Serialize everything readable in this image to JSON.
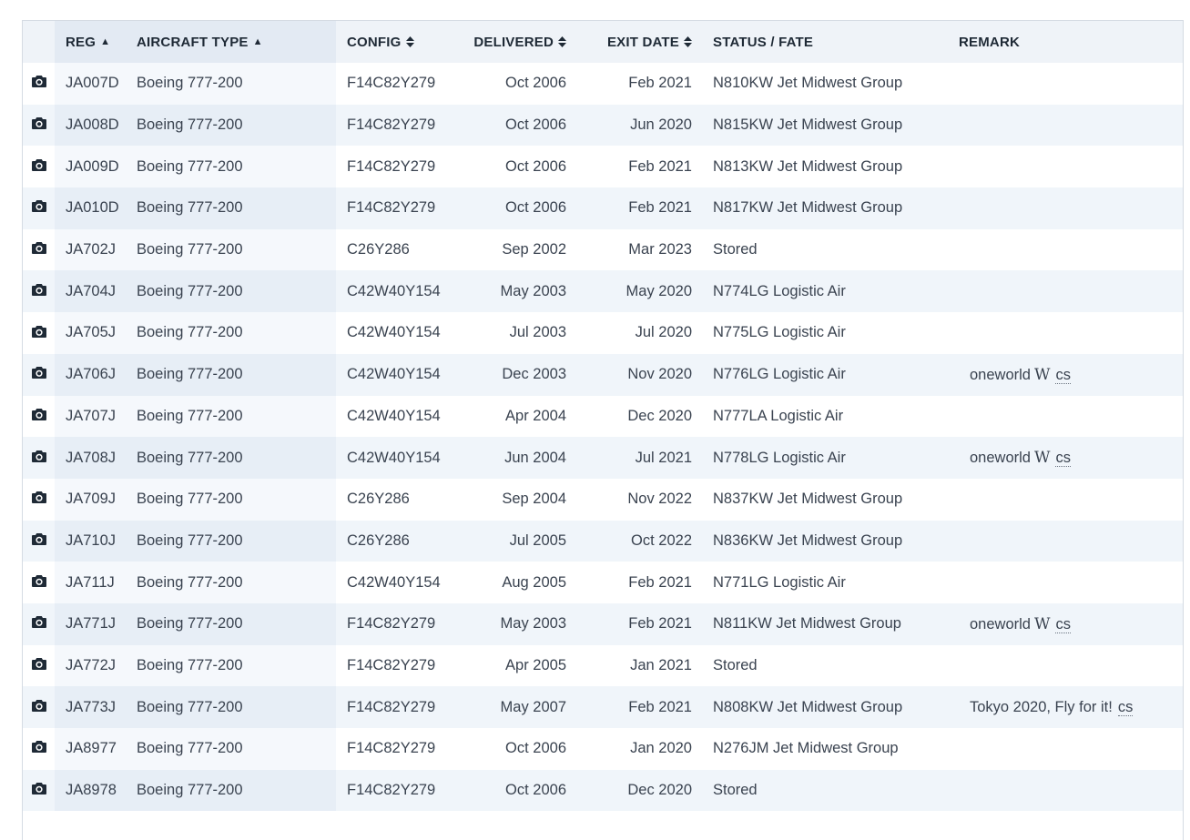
{
  "headers": {
    "reg": "REG",
    "type": "AIRCRAFT TYPE",
    "config": "CONFIG",
    "delivered": "DELIVERED",
    "exit": "EXIT DATE",
    "status": "STATUS / FATE",
    "remark": "REMARK"
  },
  "rows": [
    {
      "reg": "JA007D",
      "type": "Boeing 777-200",
      "config": "F14C82Y279",
      "delivered": "Oct 2006",
      "exit": "Feb 2021",
      "status": "N810KW Jet Midwest Group",
      "remark": "",
      "wiki": "",
      "cs": ""
    },
    {
      "reg": "JA008D",
      "type": "Boeing 777-200",
      "config": "F14C82Y279",
      "delivered": "Oct 2006",
      "exit": "Jun 2020",
      "status": "N815KW Jet Midwest Group",
      "remark": "",
      "wiki": "",
      "cs": ""
    },
    {
      "reg": "JA009D",
      "type": "Boeing 777-200",
      "config": "F14C82Y279",
      "delivered": "Oct 2006",
      "exit": "Feb 2021",
      "status": "N813KW Jet Midwest Group",
      "remark": "",
      "wiki": "",
      "cs": ""
    },
    {
      "reg": "JA010D",
      "type": "Boeing 777-200",
      "config": "F14C82Y279",
      "delivered": "Oct 2006",
      "exit": "Feb 2021",
      "status": "N817KW Jet Midwest Group",
      "remark": "",
      "wiki": "",
      "cs": ""
    },
    {
      "reg": "JA702J",
      "type": "Boeing 777-200",
      "config": "C26Y286",
      "delivered": "Sep 2002",
      "exit": "Mar 2023",
      "status": "Stored",
      "remark": "",
      "wiki": "",
      "cs": ""
    },
    {
      "reg": "JA704J",
      "type": "Boeing 777-200",
      "config": "C42W40Y154",
      "delivered": "May 2003",
      "exit": "May 2020",
      "status": "N774LG Logistic Air",
      "remark": "",
      "wiki": "",
      "cs": ""
    },
    {
      "reg": "JA705J",
      "type": "Boeing 777-200",
      "config": "C42W40Y154",
      "delivered": "Jul 2003",
      "exit": "Jul 2020",
      "status": "N775LG Logistic Air",
      "remark": "",
      "wiki": "",
      "cs": ""
    },
    {
      "reg": "JA706J",
      "type": "Boeing 777-200",
      "config": "C42W40Y154",
      "delivered": "Dec 2003",
      "exit": "Nov 2020",
      "status": "N776LG Logistic Air",
      "remark": "oneworld",
      "wiki": "W",
      "cs": "cs"
    },
    {
      "reg": "JA707J",
      "type": "Boeing 777-200",
      "config": "C42W40Y154",
      "delivered": "Apr 2004",
      "exit": "Dec 2020",
      "status": "N777LA Logistic Air",
      "remark": "",
      "wiki": "",
      "cs": ""
    },
    {
      "reg": "JA708J",
      "type": "Boeing 777-200",
      "config": "C42W40Y154",
      "delivered": "Jun 2004",
      "exit": "Jul 2021",
      "status": "N778LG Logistic Air",
      "remark": "oneworld",
      "wiki": "W",
      "cs": "cs"
    },
    {
      "reg": "JA709J",
      "type": "Boeing 777-200",
      "config": "C26Y286",
      "delivered": "Sep 2004",
      "exit": "Nov 2022",
      "status": "N837KW Jet Midwest Group",
      "remark": "",
      "wiki": "",
      "cs": ""
    },
    {
      "reg": "JA710J",
      "type": "Boeing 777-200",
      "config": "C26Y286",
      "delivered": "Jul 2005",
      "exit": "Oct 2022",
      "status": "N836KW Jet Midwest Group",
      "remark": "",
      "wiki": "",
      "cs": ""
    },
    {
      "reg": "JA711J",
      "type": "Boeing 777-200",
      "config": "C42W40Y154",
      "delivered": "Aug 2005",
      "exit": "Feb 2021",
      "status": "N771LG Logistic Air",
      "remark": "",
      "wiki": "",
      "cs": ""
    },
    {
      "reg": "JA771J",
      "type": "Boeing 777-200",
      "config": "F14C82Y279",
      "delivered": "May 2003",
      "exit": "Feb 2021",
      "status": "N811KW Jet Midwest Group",
      "remark": "oneworld",
      "wiki": "W",
      "cs": "cs"
    },
    {
      "reg": "JA772J",
      "type": "Boeing 777-200",
      "config": "F14C82Y279",
      "delivered": "Apr 2005",
      "exit": "Jan 2021",
      "status": "Stored",
      "remark": "",
      "wiki": "",
      "cs": ""
    },
    {
      "reg": "JA773J",
      "type": "Boeing 777-200",
      "config": "F14C82Y279",
      "delivered": "May 2007",
      "exit": "Feb 2021",
      "status": "N808KW Jet Midwest Group",
      "remark": "Tokyo 2020, Fly for it!",
      "wiki": "",
      "cs": "cs"
    },
    {
      "reg": "JA8977",
      "type": "Boeing 777-200",
      "config": "F14C82Y279",
      "delivered": "Oct 2006",
      "exit": "Jan 2020",
      "status": "N276JM Jet Midwest Group",
      "remark": "",
      "wiki": "",
      "cs": ""
    },
    {
      "reg": "JA8978",
      "type": "Boeing 777-200",
      "config": "F14C82Y279",
      "delivered": "Oct 2006",
      "exit": "Dec 2020",
      "status": "Stored",
      "remark": "",
      "wiki": "",
      "cs": ""
    }
  ]
}
